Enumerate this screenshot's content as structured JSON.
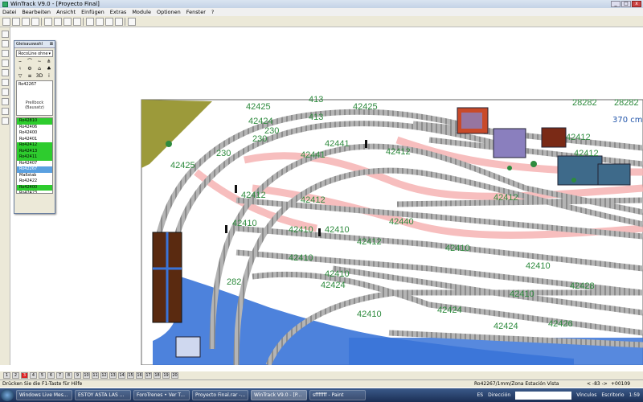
{
  "window": {
    "title": "WinTrack   V9.0 - [Proyecto Final]"
  },
  "menu": [
    "Datei",
    "Bearbeiten",
    "Ansicht",
    "Einfügen",
    "Extras",
    "Module",
    "Optionen",
    "Fenster",
    "?"
  ],
  "toolbar_icons": [
    "new-file-icon",
    "open-icon",
    "save-icon",
    "print-icon",
    "zoom-in-icon",
    "zoom-out-icon",
    "undo-icon",
    "cut-icon",
    "copy-icon",
    "paste-icon",
    "select-icon",
    "track-icon",
    "help-icon"
  ],
  "canvas": {
    "scale_label": "370 cm"
  },
  "gleis_panel": {
    "title": "Gleisauswahl",
    "library": "RocoLine ohne",
    "preview_code": "Ro42267",
    "preview_name": "Prellbock\n(Bausatz)",
    "items": [
      {
        "label": "Ro42810",
        "state": "green"
      },
      {
        "label": "Ro42406",
        "state": "none"
      },
      {
        "label": "Ro42400",
        "state": "none"
      },
      {
        "label": "Ro42401",
        "state": "none"
      },
      {
        "label": "Ro42412",
        "state": "green"
      },
      {
        "label": "Ro42413",
        "state": "green"
      },
      {
        "label": "Ro42411",
        "state": "green"
      },
      {
        "label": "Ro42407",
        "state": "none"
      },
      {
        "label": "Ro42267",
        "state": "blue"
      },
      {
        "label": "Maßstab",
        "state": "none"
      },
      {
        "label": "Ro42422",
        "state": "none"
      },
      {
        "label": "Ro42400",
        "state": "green"
      },
      {
        "label": "Ro42423",
        "state": "none"
      },
      {
        "label": "Ro42433",
        "state": "green"
      },
      {
        "label": "Ro42424",
        "state": "green"
      }
    ]
  },
  "track_labels": [
    "42425",
    "413",
    "42425",
    "413",
    "42424",
    "230",
    "42441",
    "42425",
    "42441",
    "42412",
    "42412",
    "42410",
    "42412",
    "42410",
    "42440",
    "42412",
    "42412",
    "42410",
    "42410",
    "42410",
    "42410",
    "42410",
    "42428",
    "42424",
    "42424",
    "42426",
    "28282",
    "42412",
    "42424",
    "230",
    "42410",
    "42410",
    "230",
    "282",
    "28282",
    "42412"
  ],
  "bottom_pages": [
    "1",
    "2",
    "3",
    "4",
    "5",
    "6",
    "7",
    "8",
    "9",
    "10",
    "11",
    "12",
    "13",
    "14",
    "15",
    "16",
    "17",
    "18",
    "19",
    "20"
  ],
  "status": {
    "hint": "Drücken Sie die  F1-Taste für Hilfe",
    "track_info": "Ro42267/1mm/Zona Estación Vista",
    "zoom": "< -83 ->",
    "coords": "+00109  +00322"
  },
  "taskbar": {
    "items": [
      "Windows Live Mes...",
      "ESTOY ASTA LAS ...",
      "ForoTrenes • Ver T...",
      "Proyecto Final.rar -...",
      "WinTrack   V9.0 - [P...",
      "sfffffff - Paint"
    ],
    "active_index": 4,
    "lang": "ES",
    "address_label": "Dirección",
    "tray_links": "Vínculos",
    "tray_desktop": "Escritorio",
    "clock": "1:59"
  },
  "colors": {
    "track": "#a8a8a8",
    "sleeper": "#8a8a8a",
    "hidden_track": "#f7b8b8",
    "label": "#2e8b3e",
    "water": "#3a74d8",
    "grass": "#9c9a3a",
    "scale": "#2255aa"
  }
}
